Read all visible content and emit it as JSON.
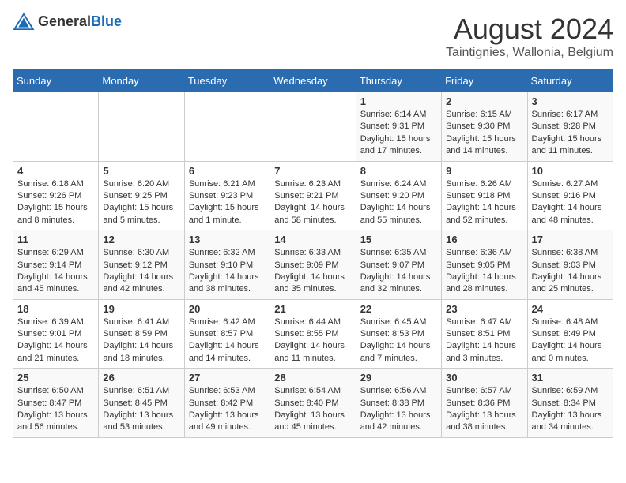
{
  "header": {
    "logo_general": "General",
    "logo_blue": "Blue",
    "title": "August 2024",
    "subtitle": "Taintignies, Wallonia, Belgium"
  },
  "weekdays": [
    "Sunday",
    "Monday",
    "Tuesday",
    "Wednesday",
    "Thursday",
    "Friday",
    "Saturday"
  ],
  "weeks": [
    [
      {
        "day": "",
        "info": ""
      },
      {
        "day": "",
        "info": ""
      },
      {
        "day": "",
        "info": ""
      },
      {
        "day": "",
        "info": ""
      },
      {
        "day": "1",
        "info": "Sunrise: 6:14 AM\nSunset: 9:31 PM\nDaylight: 15 hours and 17 minutes."
      },
      {
        "day": "2",
        "info": "Sunrise: 6:15 AM\nSunset: 9:30 PM\nDaylight: 15 hours and 14 minutes."
      },
      {
        "day": "3",
        "info": "Sunrise: 6:17 AM\nSunset: 9:28 PM\nDaylight: 15 hours and 11 minutes."
      }
    ],
    [
      {
        "day": "4",
        "info": "Sunrise: 6:18 AM\nSunset: 9:26 PM\nDaylight: 15 hours and 8 minutes."
      },
      {
        "day": "5",
        "info": "Sunrise: 6:20 AM\nSunset: 9:25 PM\nDaylight: 15 hours and 5 minutes."
      },
      {
        "day": "6",
        "info": "Sunrise: 6:21 AM\nSunset: 9:23 PM\nDaylight: 15 hours and 1 minute."
      },
      {
        "day": "7",
        "info": "Sunrise: 6:23 AM\nSunset: 9:21 PM\nDaylight: 14 hours and 58 minutes."
      },
      {
        "day": "8",
        "info": "Sunrise: 6:24 AM\nSunset: 9:20 PM\nDaylight: 14 hours and 55 minutes."
      },
      {
        "day": "9",
        "info": "Sunrise: 6:26 AM\nSunset: 9:18 PM\nDaylight: 14 hours and 52 minutes."
      },
      {
        "day": "10",
        "info": "Sunrise: 6:27 AM\nSunset: 9:16 PM\nDaylight: 14 hours and 48 minutes."
      }
    ],
    [
      {
        "day": "11",
        "info": "Sunrise: 6:29 AM\nSunset: 9:14 PM\nDaylight: 14 hours and 45 minutes."
      },
      {
        "day": "12",
        "info": "Sunrise: 6:30 AM\nSunset: 9:12 PM\nDaylight: 14 hours and 42 minutes."
      },
      {
        "day": "13",
        "info": "Sunrise: 6:32 AM\nSunset: 9:10 PM\nDaylight: 14 hours and 38 minutes."
      },
      {
        "day": "14",
        "info": "Sunrise: 6:33 AM\nSunset: 9:09 PM\nDaylight: 14 hours and 35 minutes."
      },
      {
        "day": "15",
        "info": "Sunrise: 6:35 AM\nSunset: 9:07 PM\nDaylight: 14 hours and 32 minutes."
      },
      {
        "day": "16",
        "info": "Sunrise: 6:36 AM\nSunset: 9:05 PM\nDaylight: 14 hours and 28 minutes."
      },
      {
        "day": "17",
        "info": "Sunrise: 6:38 AM\nSunset: 9:03 PM\nDaylight: 14 hours and 25 minutes."
      }
    ],
    [
      {
        "day": "18",
        "info": "Sunrise: 6:39 AM\nSunset: 9:01 PM\nDaylight: 14 hours and 21 minutes."
      },
      {
        "day": "19",
        "info": "Sunrise: 6:41 AM\nSunset: 8:59 PM\nDaylight: 14 hours and 18 minutes."
      },
      {
        "day": "20",
        "info": "Sunrise: 6:42 AM\nSunset: 8:57 PM\nDaylight: 14 hours and 14 minutes."
      },
      {
        "day": "21",
        "info": "Sunrise: 6:44 AM\nSunset: 8:55 PM\nDaylight: 14 hours and 11 minutes."
      },
      {
        "day": "22",
        "info": "Sunrise: 6:45 AM\nSunset: 8:53 PM\nDaylight: 14 hours and 7 minutes."
      },
      {
        "day": "23",
        "info": "Sunrise: 6:47 AM\nSunset: 8:51 PM\nDaylight: 14 hours and 3 minutes."
      },
      {
        "day": "24",
        "info": "Sunrise: 6:48 AM\nSunset: 8:49 PM\nDaylight: 14 hours and 0 minutes."
      }
    ],
    [
      {
        "day": "25",
        "info": "Sunrise: 6:50 AM\nSunset: 8:47 PM\nDaylight: 13 hours and 56 minutes."
      },
      {
        "day": "26",
        "info": "Sunrise: 6:51 AM\nSunset: 8:45 PM\nDaylight: 13 hours and 53 minutes."
      },
      {
        "day": "27",
        "info": "Sunrise: 6:53 AM\nSunset: 8:42 PM\nDaylight: 13 hours and 49 minutes."
      },
      {
        "day": "28",
        "info": "Sunrise: 6:54 AM\nSunset: 8:40 PM\nDaylight: 13 hours and 45 minutes."
      },
      {
        "day": "29",
        "info": "Sunrise: 6:56 AM\nSunset: 8:38 PM\nDaylight: 13 hours and 42 minutes."
      },
      {
        "day": "30",
        "info": "Sunrise: 6:57 AM\nSunset: 8:36 PM\nDaylight: 13 hours and 38 minutes."
      },
      {
        "day": "31",
        "info": "Sunrise: 6:59 AM\nSunset: 8:34 PM\nDaylight: 13 hours and 34 minutes."
      }
    ]
  ]
}
